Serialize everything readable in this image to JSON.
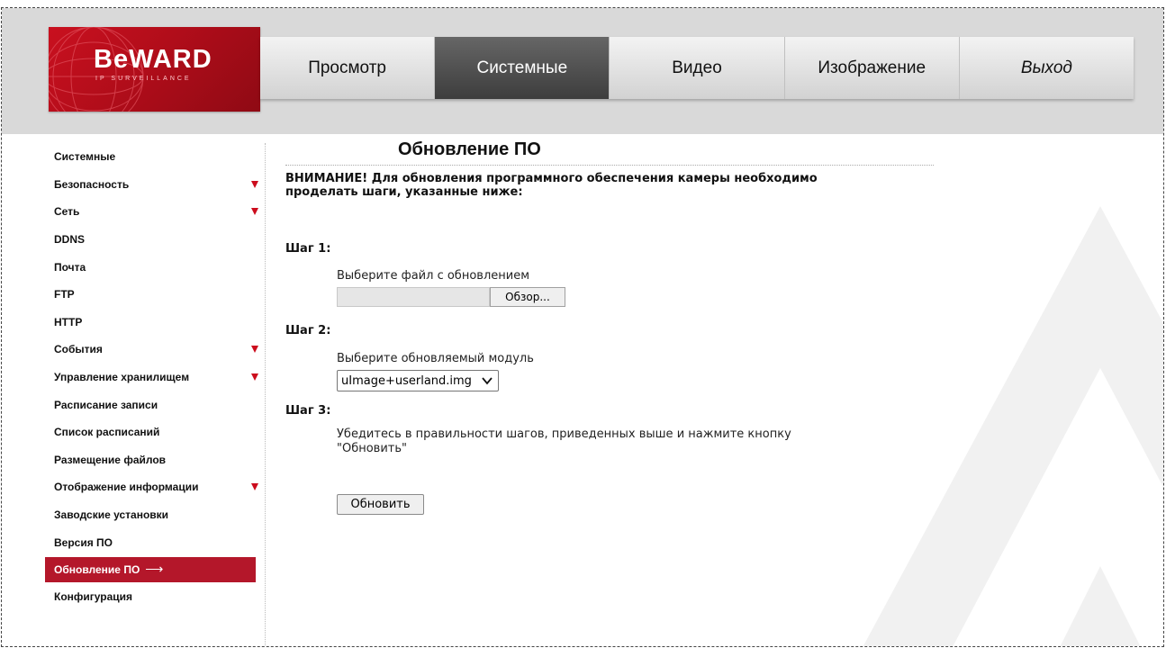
{
  "brand": {
    "logo_text": "BeWARD",
    "logo_sub": "IP SURVEILLANCE",
    "accent": "#b4172a"
  },
  "topnav": {
    "tabs": [
      {
        "label": "Просмотр",
        "active": false
      },
      {
        "label": "Системные",
        "active": true
      },
      {
        "label": "Видео",
        "active": false
      },
      {
        "label": "Изображение",
        "active": false
      },
      {
        "label": "Выход",
        "active": false
      }
    ]
  },
  "sidebar": {
    "items": [
      {
        "label": "Системные",
        "has_submenu": false
      },
      {
        "label": "Безопасность",
        "has_submenu": true
      },
      {
        "label": "Сеть",
        "has_submenu": true
      },
      {
        "label": "DDNS",
        "has_submenu": false
      },
      {
        "label": "Почта",
        "has_submenu": false
      },
      {
        "label": "FTP",
        "has_submenu": false
      },
      {
        "label": "HTTP",
        "has_submenu": false
      },
      {
        "label": "События",
        "has_submenu": true
      },
      {
        "label": "Управление хранилищем",
        "has_submenu": true
      },
      {
        "label": "Расписание записи",
        "has_submenu": false
      },
      {
        "label": "Список расписаний",
        "has_submenu": false
      },
      {
        "label": "Размещение файлов",
        "has_submenu": false
      },
      {
        "label": "Отображение информации",
        "has_submenu": true
      },
      {
        "label": "Заводские установки",
        "has_submenu": false
      },
      {
        "label": "Версия ПО",
        "has_submenu": false
      },
      {
        "label": "Обновление ПО",
        "has_submenu": false,
        "active": true
      },
      {
        "label": "Конфигурация",
        "has_submenu": false
      }
    ]
  },
  "main": {
    "title": "Обновление ПО",
    "warning": "ВНИМАНИЕ! Для обновления программного обеспечения камеры необходимо проделать шаги, указанные ниже:",
    "step1": {
      "heading": "Шаг 1:",
      "text": "Выберите файл с обновлением",
      "browse_label": "Обзор..."
    },
    "step2": {
      "heading": "Шаг 2:",
      "text": "Выберите обновляемый модуль",
      "selected": "uImage+userland.img"
    },
    "step3": {
      "heading": "Шаг 3:",
      "text": "Убедитесь в правильности шагов, приведенных выше и нажмите кнопку \"Обновить\""
    },
    "update_label": "Обновить"
  }
}
